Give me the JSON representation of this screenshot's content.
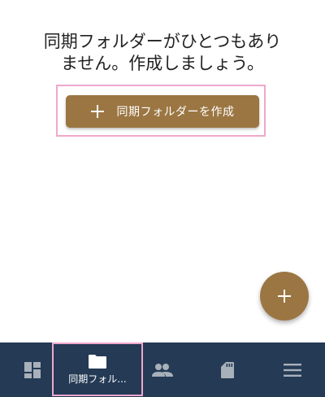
{
  "empty_state": {
    "message_line1": "同期フォルダーがひとつもあり",
    "message_line2": "ません。作成しましょう。",
    "create_button_label": "同期フォルダーを作成"
  },
  "fab": {
    "icon": "plus-icon"
  },
  "bottom_nav": {
    "items": [
      {
        "icon": "dashboard-icon",
        "label": ""
      },
      {
        "icon": "folder-icon",
        "label": "同期フォル..."
      },
      {
        "icon": "people-icon",
        "label": ""
      },
      {
        "icon": "sd-card-icon",
        "label": ""
      },
      {
        "icon": "menu-icon",
        "label": ""
      }
    ],
    "selected_index": 1
  },
  "colors": {
    "accent": "#9b7642",
    "nav_background": "#243a55",
    "nav_icon": "#a8b0ba",
    "highlight": "#f0a8cc"
  }
}
